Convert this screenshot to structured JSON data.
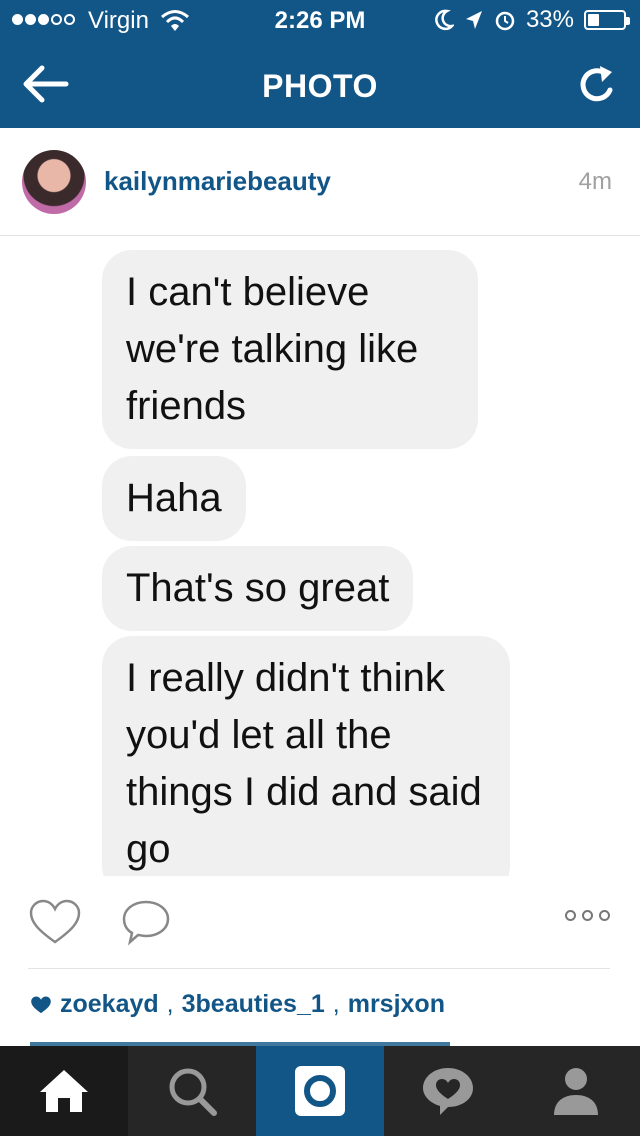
{
  "status_bar": {
    "signal_filled": 3,
    "signal_total": 5,
    "carrier": "Virgin",
    "time": "2:26 PM",
    "battery_text": "33%",
    "battery_level": 0.33
  },
  "nav": {
    "title": "PHOTO",
    "back_icon": "arrow-left-icon",
    "refresh_icon": "refresh-icon"
  },
  "post": {
    "username": "kailynmariebeauty",
    "time_ago": "4m"
  },
  "messages": [
    "I can't believe we're talking like friends",
    "Haha",
    "That's so great",
    "I really didn't think you'd let all the things I did and said go"
  ],
  "likes": {
    "users": [
      "zoekayd",
      "3beauties_1",
      "mrsjxon"
    ]
  },
  "tabbar": {
    "items": [
      "home-icon",
      "search-icon",
      "camera-icon",
      "activity-icon",
      "profile-icon"
    ]
  },
  "colors": {
    "brand": "#125688",
    "bubble": "#f0f0f0",
    "tabbar": "#262626"
  }
}
